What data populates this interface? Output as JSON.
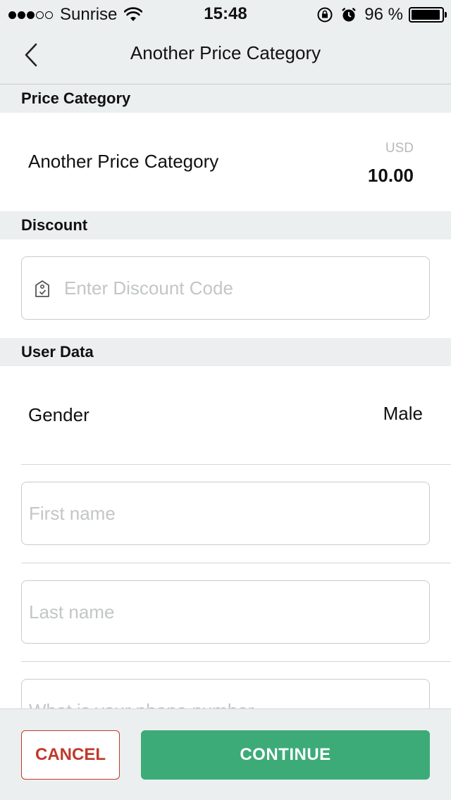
{
  "status_bar": {
    "carrier": "Sunrise",
    "signal_bars_filled": 3,
    "signal_bars_total": 5,
    "time": "15:48",
    "battery_text": "96 %",
    "battery_level": 0.96,
    "icons": [
      "wifi-icon",
      "rotation-lock-icon",
      "alarm-icon",
      "battery-icon"
    ]
  },
  "nav": {
    "title": "Another Price Category",
    "back_icon": "chevron-left-icon"
  },
  "price_section": {
    "header": "Price Category",
    "item_name": "Another Price Category",
    "currency": "USD",
    "amount": "10.00"
  },
  "discount_section": {
    "header": "Discount",
    "placeholder": "Enter Discount Code",
    "icon": "discount-tag-icon"
  },
  "user_data_section": {
    "header": "User Data",
    "gender_label": "Gender",
    "gender_value": "Male",
    "first_name_placeholder": "First name",
    "last_name_placeholder": "Last name",
    "phone_placeholder": "What is your phone number"
  },
  "footer": {
    "cancel_label": "CANCEL",
    "continue_label": "CONTINUE"
  },
  "colors": {
    "background_gray": "#ecefef",
    "accent_green": "#3dab78",
    "cancel_red": "#c0392b",
    "placeholder_gray": "#c3c6c7"
  }
}
